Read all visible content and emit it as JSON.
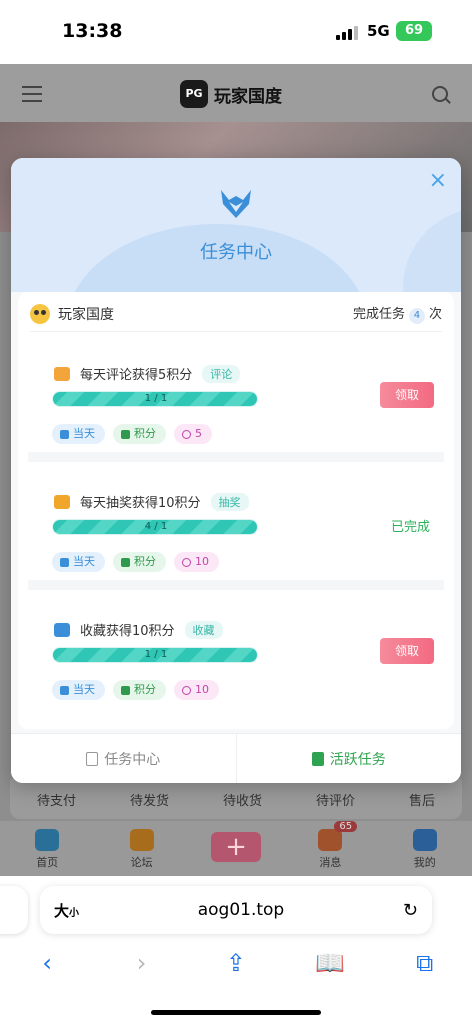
{
  "status": {
    "time": "13:38",
    "network": "5G",
    "battery": "69"
  },
  "page": {
    "logo_badge": "PG",
    "logo_name": "玩家国度",
    "orders": [
      "待支付",
      "待发货",
      "待收货",
      "待评价",
      "售后"
    ],
    "tabbar": [
      {
        "label": "首页",
        "icon": "home-icon",
        "color": "#2a6f97"
      },
      {
        "label": "论坛",
        "icon": "forum-icon",
        "color": "#a76c1c"
      },
      {
        "label": "",
        "icon": "plus-icon",
        "color": "#b4566e"
      },
      {
        "label": "消息",
        "icon": "bell-icon",
        "color": "#a0522d",
        "count": "65"
      },
      {
        "label": "我的",
        "icon": "user-icon",
        "color": "#2a5f97"
      }
    ]
  },
  "modal": {
    "title": "任务中心",
    "close": "×",
    "username": "玩家国度",
    "done_prefix": "完成任务",
    "done_count": "4",
    "done_suffix": "次",
    "tasks": [
      {
        "name": "每天评论获得5积分",
        "tag": "评论",
        "progress": "1 / 1",
        "progress_fraction": 1.0,
        "icon_color": "#f3a43a",
        "chips": {
          "day": "当天",
          "points": "积分",
          "coins": "5"
        },
        "action": "领取",
        "status": ""
      },
      {
        "name": "每天抽奖获得10积分",
        "tag": "抽奖",
        "progress": "4 / 1",
        "progress_fraction": 1.0,
        "icon_color": "#f0a62a",
        "chips": {
          "day": "当天",
          "points": "积分",
          "coins": "10"
        },
        "action": "",
        "status": "已完成"
      },
      {
        "name": "收藏获得10积分",
        "tag": "收藏",
        "progress": "1 / 1",
        "progress_fraction": 1.0,
        "icon_color": "#3a8fd8",
        "chips": {
          "day": "当天",
          "points": "积分",
          "coins": "10"
        },
        "action": "领取",
        "status": ""
      }
    ],
    "footer": {
      "left": "任务中心",
      "right": "活跃任务"
    }
  },
  "browser": {
    "size_label": "大",
    "size_small": "小",
    "url": "aog01.top",
    "reload_icon": "↻",
    "nav": [
      {
        "name": "back-button",
        "glyph": "‹",
        "disabled": false
      },
      {
        "name": "forward-button",
        "glyph": "›",
        "disabled": true
      },
      {
        "name": "share-button",
        "glyph": "⇪",
        "disabled": false
      },
      {
        "name": "bookmarks-button",
        "glyph": "📖",
        "disabled": false
      },
      {
        "name": "tabs-button",
        "glyph": "⧉",
        "disabled": false
      }
    ]
  },
  "colors": {
    "accent": "#3a8fd8",
    "claim": "#f36a82",
    "complete": "#2fb15c",
    "progress": "#2fc6b5"
  }
}
